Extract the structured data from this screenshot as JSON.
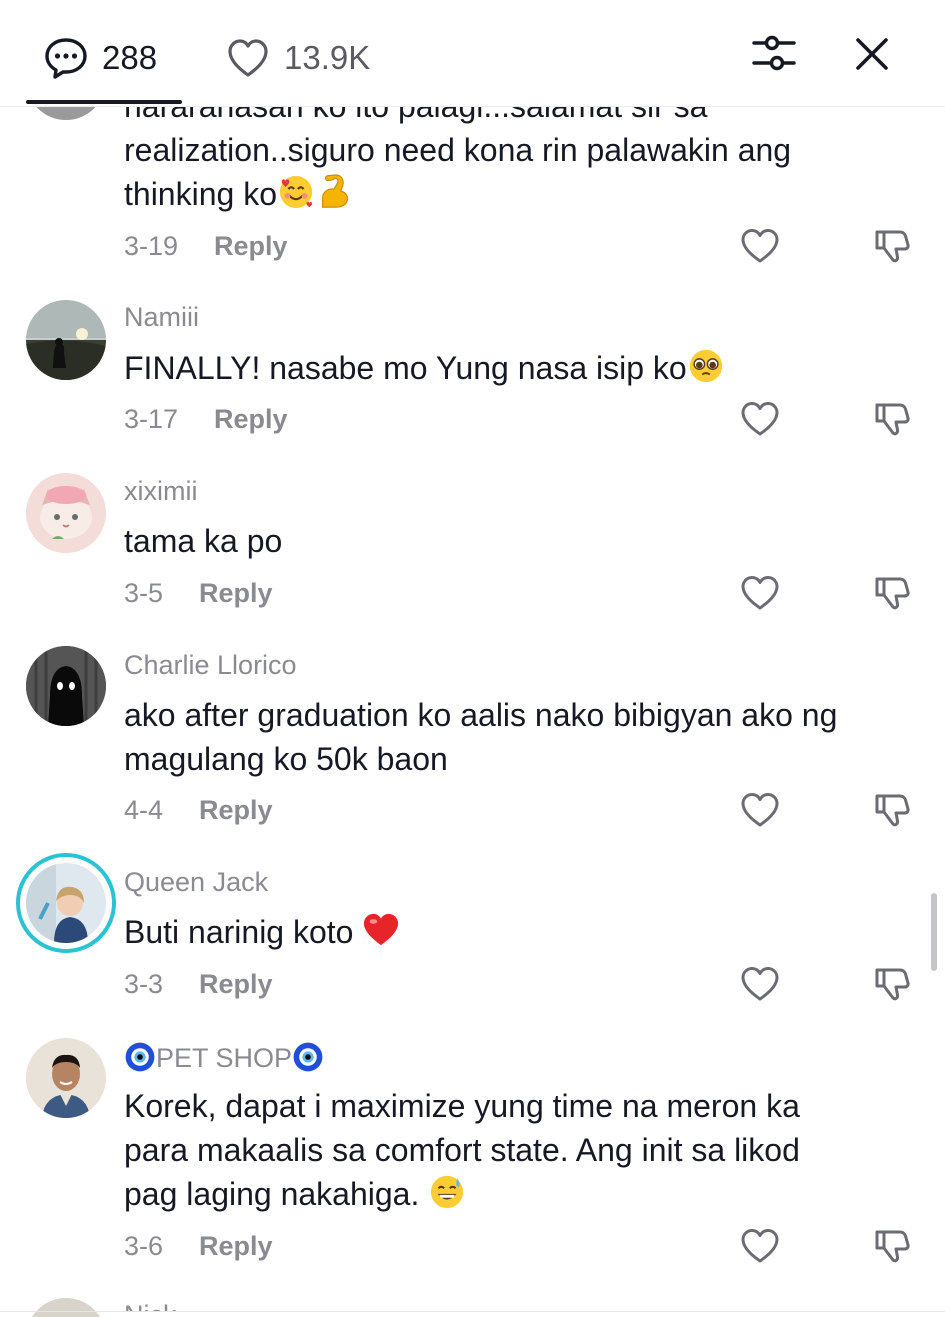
{
  "header": {
    "comment_count": "288",
    "like_count": "13.9K",
    "comment_icon": "comment-bubble-icon",
    "like_icon": "heart-outline-icon",
    "filter_icon": "filter-sliders-icon",
    "close_icon": "close-icon"
  },
  "partial_comment": {
    "text_cut_line": "nararanasan ko ito palagi...salamat sir sa",
    "text_line2": "realization..siguro need kona rin palawakin ang",
    "text_line3": "thinking ko",
    "emojis": [
      "smiling-face-with-hearts",
      "flexed-biceps"
    ],
    "date": "3-19",
    "reply_label": "Reply"
  },
  "comments": [
    {
      "username": "Namiii",
      "text": "FINALLY! nasabe mo Yung nasa isip ko",
      "emoji": "pleading-face",
      "date": "3-17",
      "reply_label": "Reply"
    },
    {
      "username": "xiximii",
      "text": "tama ka po",
      "date": "3-5",
      "reply_label": "Reply"
    },
    {
      "username": "Charlie Llorico",
      "text_line1": "ako after graduation ko aalis nako bibigyan ako ng",
      "text_line2": "magulang ko 50k baon",
      "date": "4-4",
      "reply_label": "Reply"
    },
    {
      "username": "Queen Jack",
      "text": "Buti narinig koto",
      "emoji": "red-heart",
      "date": "3-3",
      "reply_label": "Reply"
    },
    {
      "username": "PET SHOP",
      "username_emoji": "nazar-amulet",
      "text_line1": "Korek, dapat i maximize yung time na meron ka",
      "text_line2": "para makaalis sa comfort state. Ang init sa likod",
      "text_line3": "pag laging nakahiga.",
      "emoji": "grinning-face-with-sweat",
      "date": "3-6",
      "reply_label": "Reply"
    }
  ],
  "next_peek_username": "Nick",
  "colors": {
    "text_primary": "#161823",
    "text_secondary": "#8a8b91",
    "story_ring": "#29c3d2"
  }
}
